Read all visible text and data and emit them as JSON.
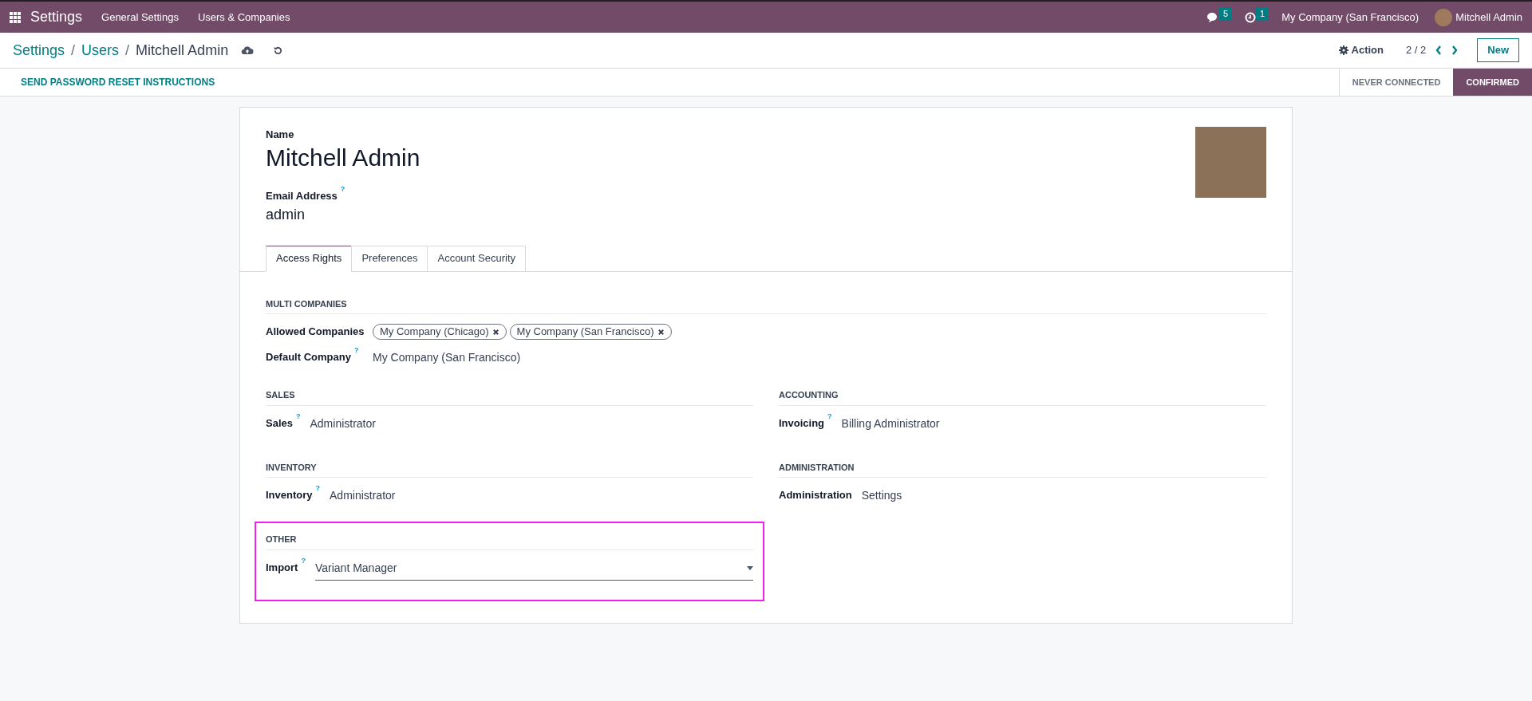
{
  "navbar": {
    "app": "Settings",
    "menu": [
      "General Settings",
      "Users & Companies"
    ],
    "messages_count": "5",
    "activities_count": "1",
    "company": "My Company (San Francisco)",
    "user": "Mitchell Admin"
  },
  "breadcrumbs": [
    "Settings",
    "Users",
    "Mitchell Admin"
  ],
  "breadcrumb_separator": "/",
  "control": {
    "action": "Action",
    "pager": "2 / 2",
    "new": "New"
  },
  "statusbar": {
    "button": "SEND PASSWORD RESET INSTRUCTIONS",
    "stages": [
      {
        "label": "NEVER CONNECTED",
        "selected": false
      },
      {
        "label": "CONFIRMED",
        "selected": true
      }
    ]
  },
  "form": {
    "name_label": "Name",
    "name": "Mitchell Admin",
    "email_label": "Email Address",
    "email_help": "?",
    "email": "admin",
    "tabs": [
      {
        "label": "Access Rights",
        "selected": true
      },
      {
        "label": "Preferences",
        "selected": false
      },
      {
        "label": "Account Security",
        "selected": false
      }
    ],
    "multi": {
      "title": "MULTI COMPANIES",
      "fields": [
        {
          "kind": "tags",
          "label": "Allowed Companies",
          "tags": [
            "My Company (Chicago)",
            "My Company (San Francisco)"
          ]
        },
        {
          "kind": "text",
          "label": "Default Company",
          "help": "?",
          "value": "My Company (San Francisco)"
        }
      ]
    },
    "sections": [
      {
        "title": "SALES",
        "highlighted": false,
        "field": {
          "kind": "text",
          "label": "Sales",
          "help": "?",
          "value": "Administrator"
        }
      },
      {
        "title": "ACCOUNTING",
        "highlighted": false,
        "field": {
          "kind": "text",
          "label": "Invoicing",
          "help": "?",
          "value": "Billing Administrator"
        }
      },
      {
        "title": "INVENTORY",
        "highlighted": false,
        "field": {
          "kind": "text",
          "label": "Inventory",
          "help": "?",
          "value": "Administrator"
        }
      },
      {
        "title": "ADMINISTRATION",
        "highlighted": false,
        "field": {
          "kind": "text",
          "label": "Administration",
          "value": "Settings"
        }
      },
      {
        "title": "OTHER",
        "highlighted": true,
        "field": {
          "kind": "select",
          "label": "Import",
          "help": "?",
          "value": "Variant Manager"
        }
      }
    ]
  }
}
